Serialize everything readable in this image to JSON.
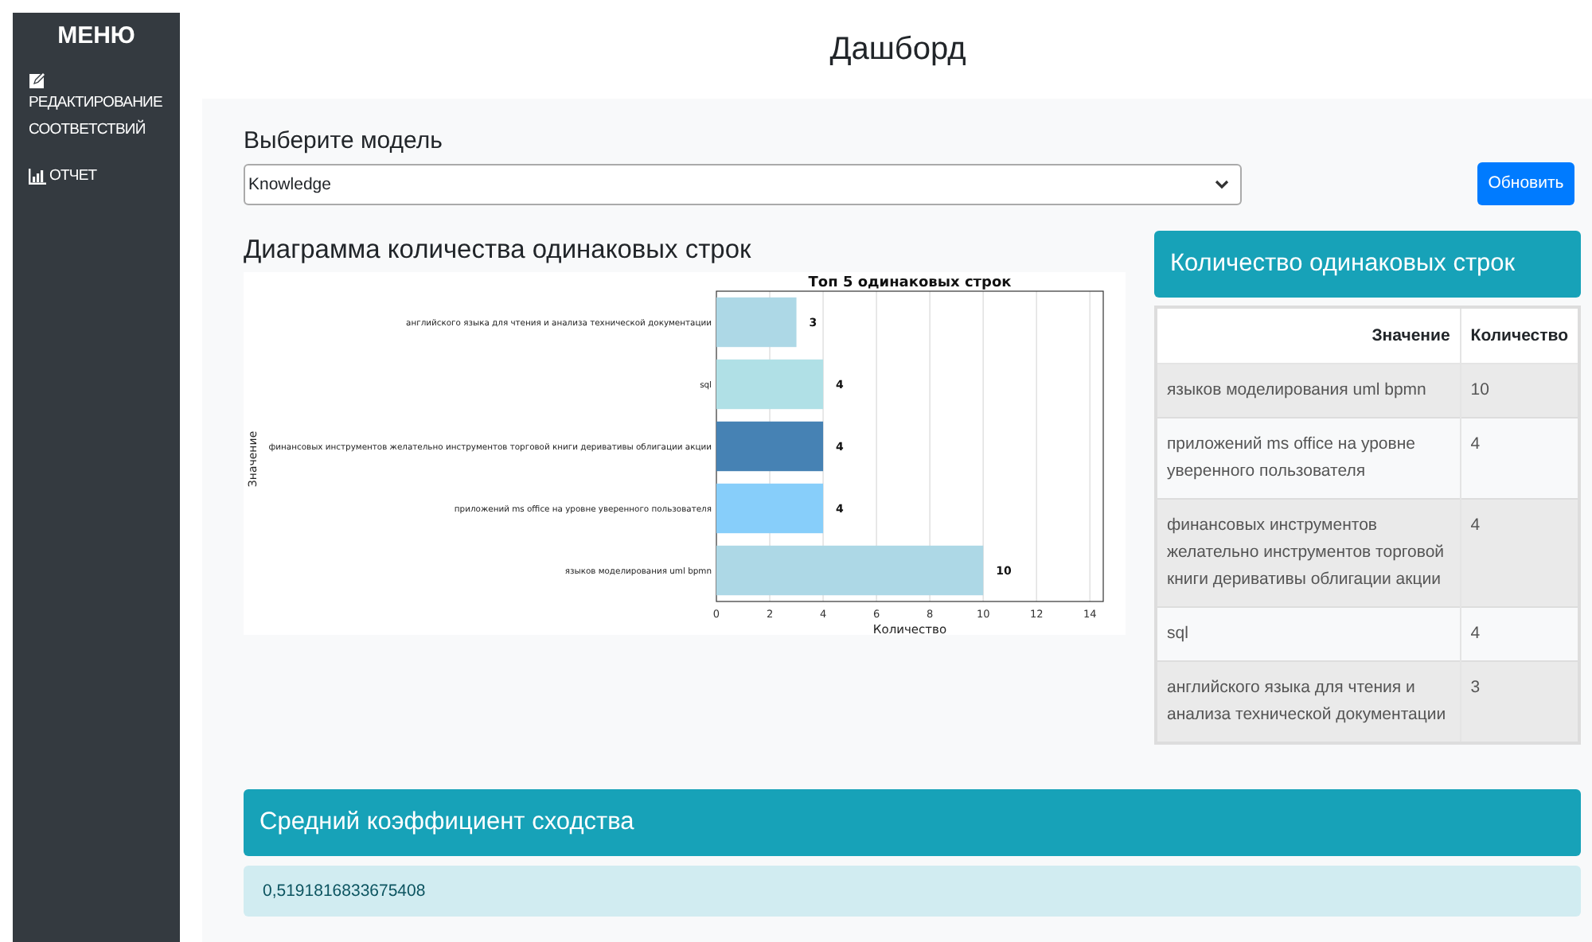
{
  "sidebar": {
    "title": "МЕНЮ",
    "items": [
      {
        "kind": "edit",
        "label": "РЕДАКТИРОВАНИЕ СООТВЕТСТВИЙ"
      },
      {
        "kind": "report",
        "label": "ОТЧЕТ"
      }
    ]
  },
  "page_title": "Дашборд",
  "model_select": {
    "label": "Выберите модель",
    "value": "Knowledge"
  },
  "refresh_button": "Обновить",
  "chart_section": {
    "heading": "Диаграмма количества одинаковых строк",
    "chart_data": {
      "type": "bar",
      "orientation": "horizontal",
      "title": "Топ 5 одинаковых строк",
      "xlabel": "Количество",
      "ylabel": "Значение",
      "categories": [
        "английского языка для чтения и анализа технической документации",
        "sql",
        "финансовых инструментов желательно инструментов торговой книги деривативы облигации акции",
        "приложений ms office на уровне уверенного пользователя",
        "языков моделирования uml bpmn"
      ],
      "series": [
        {
          "color": "#add8e6",
          "values": [
            3,
            null,
            null,
            null,
            10
          ]
        },
        {
          "color": "#b0e0e6",
          "values": [
            null,
            4,
            null,
            null,
            null
          ]
        },
        {
          "color": "#4682b4",
          "values": [
            null,
            null,
            4,
            null,
            null
          ]
        },
        {
          "color": "#87cefa",
          "values": [
            null,
            null,
            null,
            4,
            null
          ]
        }
      ],
      "xlim": [
        0,
        14.5
      ],
      "xticks": [
        0,
        2,
        4,
        6,
        8,
        10,
        12,
        14
      ],
      "grid": true,
      "data_labels": true
    }
  },
  "counts_card": {
    "title": "Количество одинаковых строк",
    "columns": [
      "Значение",
      "Количество"
    ],
    "rows": [
      [
        "языков моделирования uml bpmn",
        "10"
      ],
      [
        "приложений ms office на уровне уверенного пользователя",
        "4"
      ],
      [
        "финансовых инструментов желательно инструментов торговой книги деривативы облигации акции",
        "4"
      ],
      [
        "sql",
        "4"
      ],
      [
        "английского языка для чтения и анализа технической документации",
        "3"
      ]
    ]
  },
  "similarity_card": {
    "title": "Средний коэффициент сходства",
    "value": "0,5191816833675408"
  }
}
